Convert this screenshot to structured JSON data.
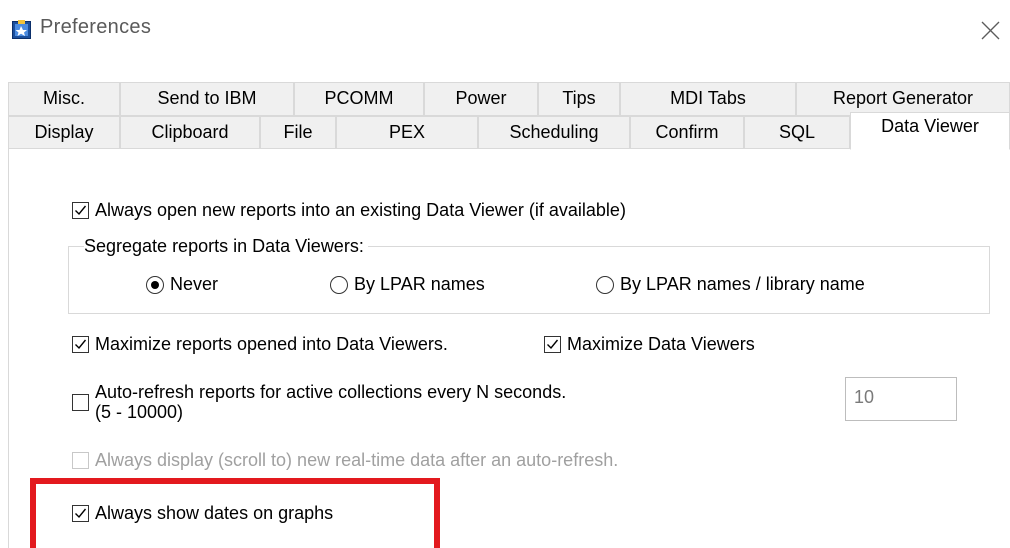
{
  "window": {
    "title": "Preferences",
    "icon": "preferences-app-icon",
    "close_icon": "close-icon"
  },
  "tabs": {
    "row1": [
      "Misc.",
      "Send to IBM",
      "PCOMM",
      "Power",
      "Tips",
      "MDI Tabs",
      "Report Generator"
    ],
    "row2": [
      "Display",
      "Clipboard",
      "File",
      "PEX",
      "Scheduling",
      "Confirm",
      "SQL",
      "Data Viewer"
    ],
    "selected": "Data Viewer"
  },
  "data_viewer": {
    "always_open_existing": {
      "label": "Always open new reports into an existing Data Viewer (if available)",
      "checked": true
    },
    "segregate": {
      "legend": "Segregate reports in Data Viewers:",
      "options": [
        "Never",
        "By LPAR names",
        "By LPAR names / library name"
      ],
      "selected": "Never"
    },
    "maximize_reports": {
      "label": "Maximize reports opened into Data Viewers.",
      "checked": true
    },
    "maximize_viewers": {
      "label": "Maximize Data Viewers",
      "checked": true
    },
    "auto_refresh": {
      "label_line1": "Auto-refresh reports for active collections every N seconds.",
      "label_line2": "(5 - 10000)",
      "checked": false,
      "seconds_value": "10"
    },
    "always_display_new": {
      "label": "Always display (scroll to) new real-time data after an auto-refresh.",
      "checked": false,
      "enabled": false
    },
    "show_dates": {
      "label": "Always show dates on graphs",
      "checked": true
    }
  },
  "colors": {
    "highlight": "#e3191e",
    "tab_border": "#d9d9d9",
    "disabled_text": "#a0a0a0"
  }
}
